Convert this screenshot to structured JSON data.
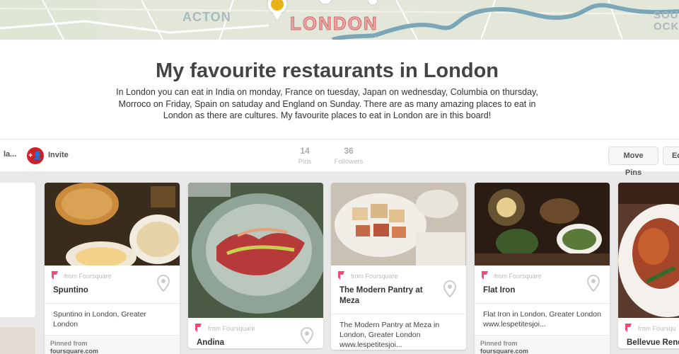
{
  "map": {
    "labels": {
      "acton": "ACTON",
      "london": "LONDON",
      "south_1": "SOU",
      "south_2": "OCKE"
    },
    "colors": {
      "land": "#e3e7da",
      "river": "#7aa6b8",
      "roads": "#ffffff",
      "park": "#cfdcc4"
    }
  },
  "board": {
    "title": "My favourite restaurants in London",
    "description": "In London you can eat in India on monday, France on tuesday, Japan on wednesday, Columbia on thursday, Morroco on Friday, Spain on satuday and England on Sunday. There are as many amazing places to eat in London as there are cultures. My favourite places to eat in London are in this board!"
  },
  "action_bar": {
    "owner_label": "la...",
    "invite_icon": "+👤",
    "invite_label": "Invite",
    "pins_count": "14",
    "pins_label": "Pins",
    "followers_count": "36",
    "followers_label": "Followers",
    "move_pins_label": "Move Pins",
    "edit_label": "Ed"
  },
  "pins": [
    {
      "source": "from Foursquare",
      "name": "Spuntino",
      "description": "Spuntino in London, Greater London",
      "pinned_from": "Pinned from",
      "site": "foursquare.com"
    },
    {
      "source": "from Foursquare",
      "name": "Andina",
      "description": "",
      "pinned_from": "",
      "site": ""
    },
    {
      "source": "from Foursquare",
      "name": "The Modern Pantry at Meza",
      "description": "The Modern Pantry at Meza in London, Greater London www.lespetitesjoi...",
      "pinned_from": "",
      "site": ""
    },
    {
      "source": "from Foursquare",
      "name": "Flat Iron",
      "description": "Flat Iron in London, Greater London www.lespetitesjoi...",
      "pinned_from": "Pinned from",
      "site": "foursquare.com"
    },
    {
      "source": "from Foursqu",
      "name": "Bellevue Rend",
      "description": "",
      "pinned_from": "",
      "site": ""
    }
  ],
  "colors": {
    "brand_red": "#cb2027",
    "foursquare_pink": "#f94877",
    "text_dark": "#333333",
    "muted": "#aaaaaa"
  }
}
